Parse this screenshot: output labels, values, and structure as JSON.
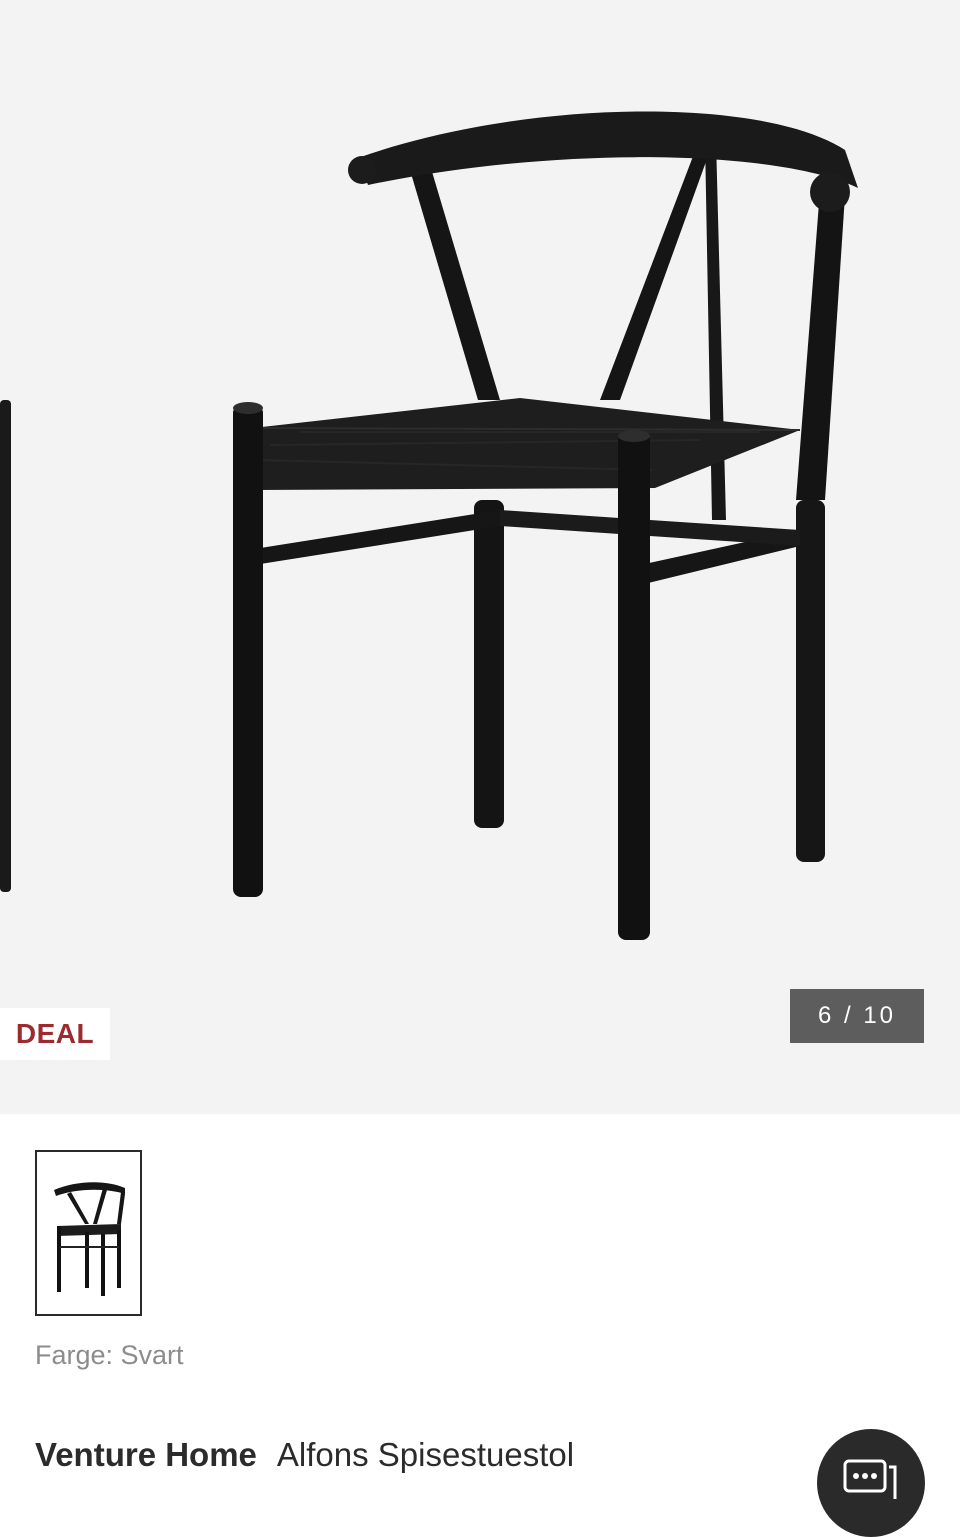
{
  "gallery": {
    "badge": "DEAL",
    "counter": "6 / 10",
    "image_alt": "chair-photo"
  },
  "product": {
    "color_label": "Farge: Svart",
    "brand": "Venture Home",
    "name": "Alfons Spisestuestol"
  },
  "colors": {
    "gallery_bg": "#f3f3f3",
    "deal_text": "#9b2b2f",
    "counter_bg": "#5d5d5d",
    "chair": "#161616"
  },
  "icons": {
    "chat": "chat-bubble-icon"
  }
}
